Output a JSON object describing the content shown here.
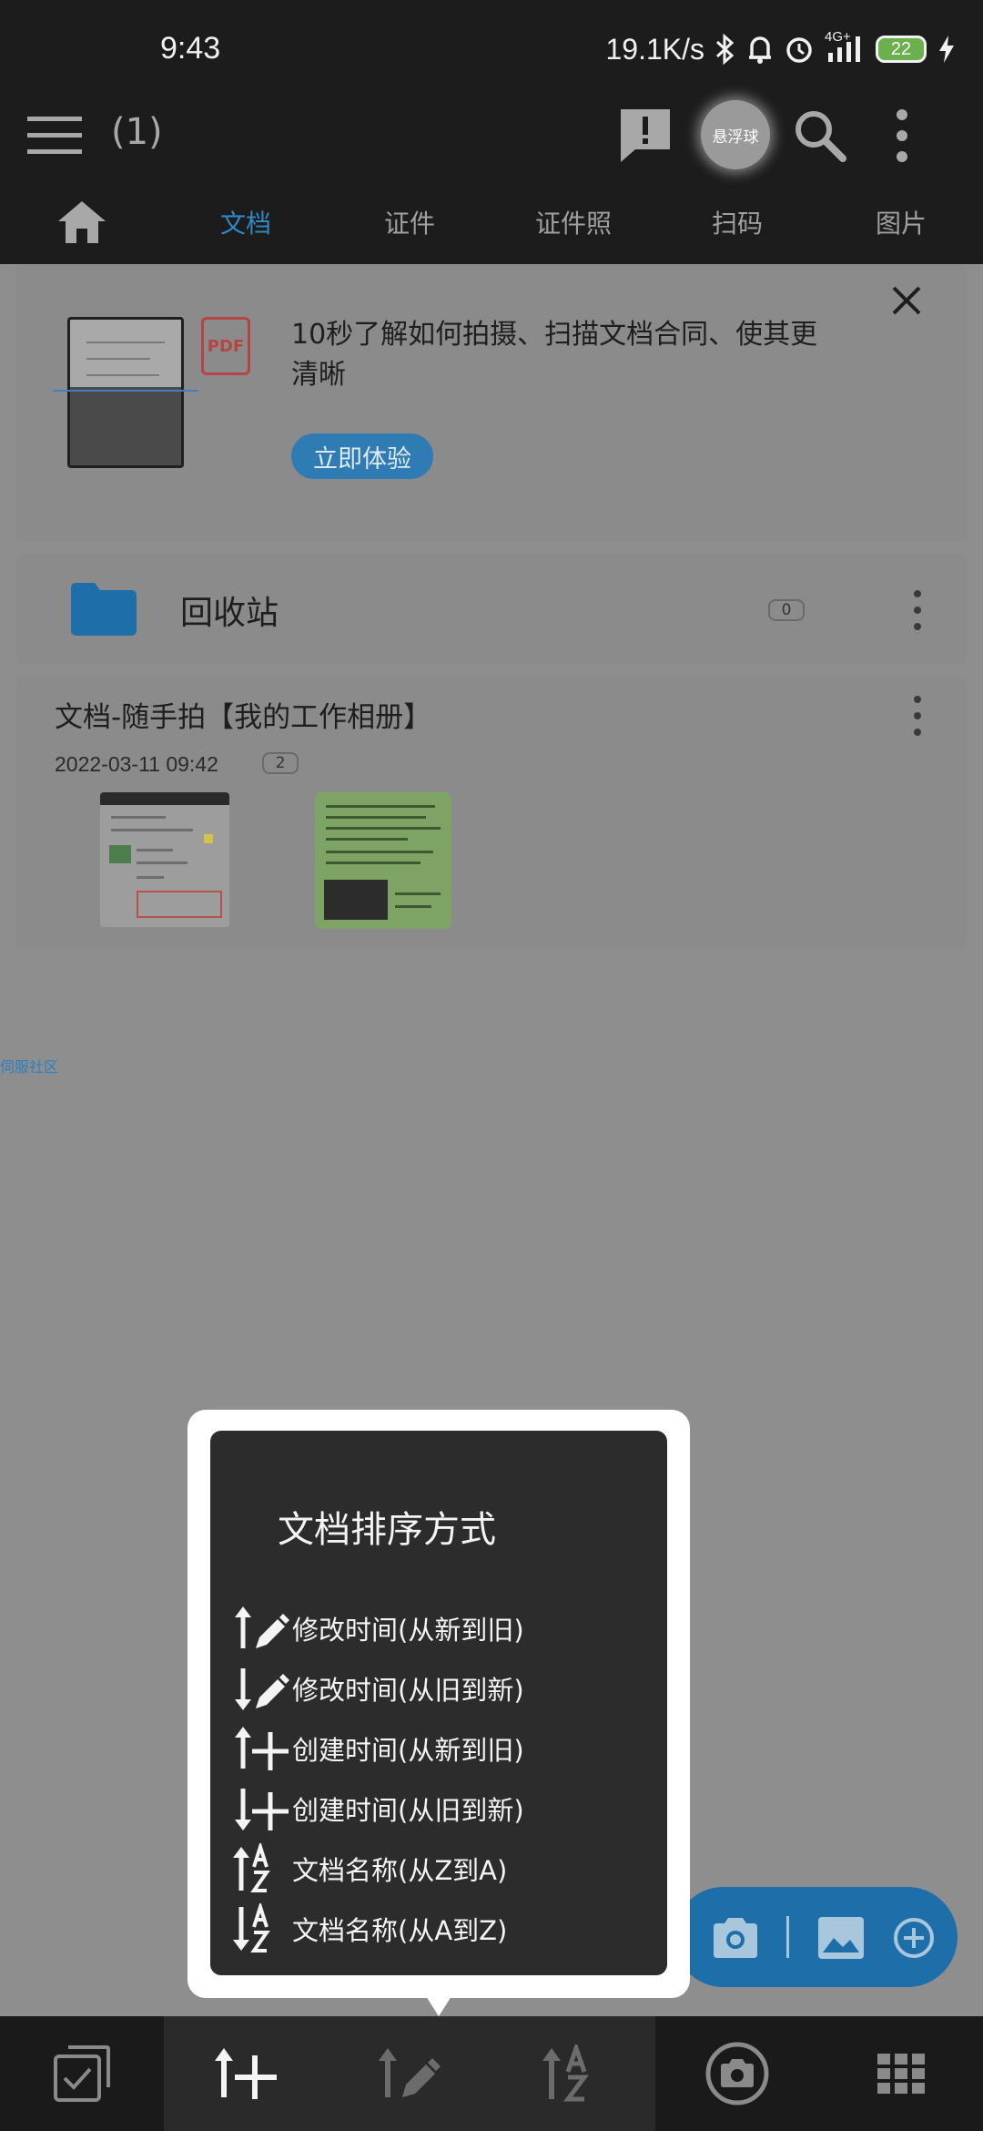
{
  "status_bar": {
    "time": "9:43",
    "net_speed": "19.1K/s",
    "network_type": "4G+",
    "battery": "22"
  },
  "app_bar": {
    "item_count": "(1)",
    "float_ball_label": "悬浮球"
  },
  "tabs": [
    {
      "label": "文档",
      "active": true
    },
    {
      "label": "证件",
      "active": false
    },
    {
      "label": "证件照",
      "active": false
    },
    {
      "label": "扫码",
      "active": false
    },
    {
      "label": "图片",
      "active": false
    }
  ],
  "promo": {
    "pdf_badge": "PDF",
    "text": "10秒了解如何拍摄、扫描文档合同、使其更清晰",
    "button_label": "立即体验"
  },
  "recycle_bin": {
    "label": "回收站",
    "count": "0"
  },
  "document": {
    "title": "文档-随手拍【我的工作相册】",
    "date": "2022-03-11 09:42",
    "page_count": "2"
  },
  "community_link": "伺服社区",
  "sort_popup": {
    "title": "文档排序方式",
    "options": [
      {
        "label": "修改时间(从新到旧)",
        "icon": "sort-modified-desc-icon"
      },
      {
        "label": "修改时间(从旧到新)",
        "icon": "sort-modified-asc-icon"
      },
      {
        "label": "创建时间(从新到旧)",
        "icon": "sort-created-desc-icon"
      },
      {
        "label": "创建时间(从旧到新)",
        "icon": "sort-created-asc-icon"
      },
      {
        "label": "文档名称(从Z到A)",
        "icon": "sort-name-desc-icon"
      },
      {
        "label": "文档名称(从A到Z)",
        "icon": "sort-name-asc-icon"
      }
    ]
  },
  "bottom_bar": {
    "items": [
      "multi-select-icon",
      "sort-created-icon",
      "sort-modified-icon",
      "sort-name-icon",
      "camera-icon",
      "grid-view-icon"
    ],
    "selected": "sort-created-icon"
  },
  "colors": {
    "accent": "#2f89c5",
    "fab": "#1d6ea9",
    "dark_bar": "#1c1c1c",
    "scrim_background": "#8e8e8e"
  }
}
